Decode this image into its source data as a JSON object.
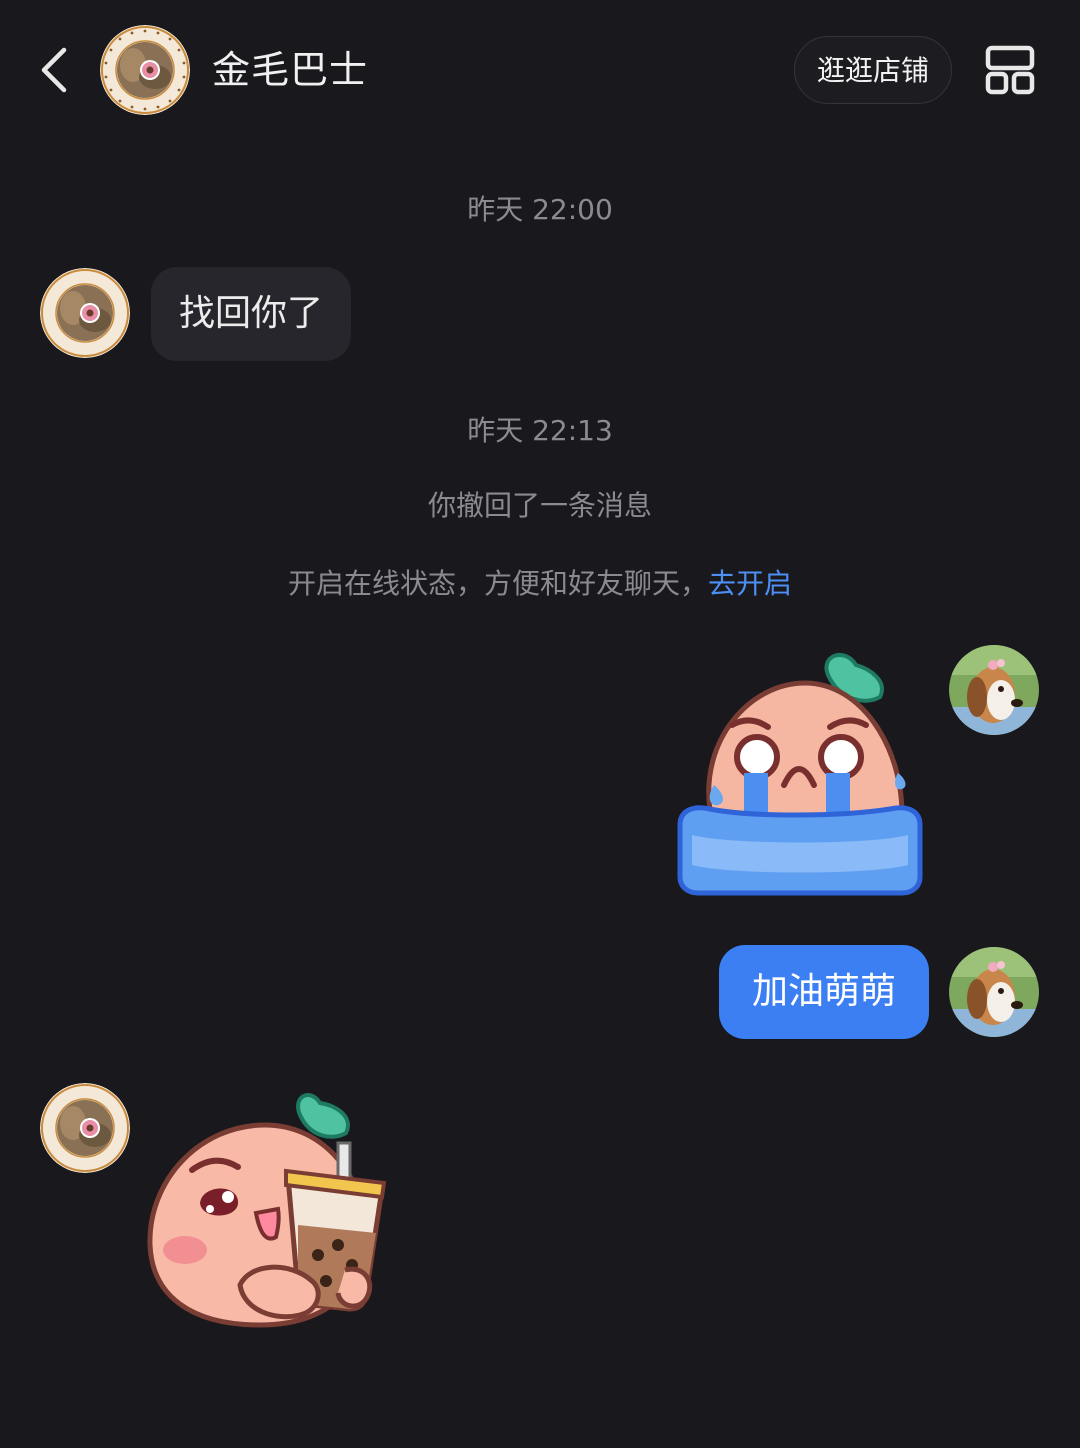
{
  "header": {
    "title": "金毛巴士",
    "store_button": "逛逛店铺",
    "avatar_seal_text": "Golden Retriever · We love Golden"
  },
  "messages": {
    "time_1": "昨天 22:00",
    "incoming_text": "找回你了",
    "time_2": "昨天 22:13",
    "recall_notice": "你撤回了一条消息",
    "online_prompt": "开启在线状态，方便和好友聊天，",
    "online_link": "去开启",
    "outgoing_text": "加油萌萌"
  },
  "stickers": {
    "outgoing": "crying-peach-sticker",
    "incoming": "peach-bubble-tea-sticker"
  },
  "colors": {
    "background": "#18181d",
    "incoming_bubble": "#26262c",
    "outgoing_bubble": "#3b7ff3",
    "link": "#4d8ff5",
    "system_text": "#8a8a90"
  }
}
